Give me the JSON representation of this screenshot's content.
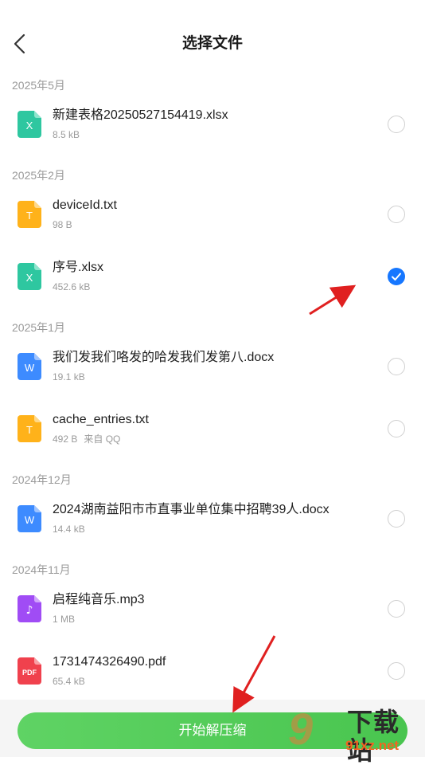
{
  "header": {
    "title": "选择文件",
    "back_icon": "chevron-left-icon"
  },
  "groups": [
    {
      "label": "2025年5月",
      "files": [
        {
          "name": "新建表格20250527154419.xlsx",
          "size": "8.5 kB",
          "source": "",
          "type": "xlsx",
          "checked": false
        }
      ]
    },
    {
      "label": "2025年2月",
      "files": [
        {
          "name": "deviceId.txt",
          "size": "98 B",
          "source": "",
          "type": "txt",
          "checked": false
        },
        {
          "name": "序号.xlsx",
          "size": "452.6 kB",
          "source": "",
          "type": "xlsx",
          "checked": true
        }
      ]
    },
    {
      "label": "2025年1月",
      "files": [
        {
          "name": "我们发我们咯发的哈发我们发第八.docx",
          "size": "19.1 kB",
          "source": "",
          "type": "docx",
          "checked": false
        },
        {
          "name": "cache_entries.txt",
          "size": "492 B",
          "source": "来自 QQ",
          "type": "txt",
          "checked": false
        }
      ]
    },
    {
      "label": "2024年12月",
      "files": [
        {
          "name": "2024湖南益阳市市直事业单位集中招聘39人.docx",
          "size": "14.4 kB",
          "source": "",
          "type": "docx",
          "checked": false
        }
      ]
    },
    {
      "label": "2024年11月",
      "files": [
        {
          "name": "启程纯音乐.mp3",
          "size": "1 MB",
          "source": "",
          "type": "mp3",
          "checked": false
        },
        {
          "name": "1731474326490.pdf",
          "size": "65.4 kB",
          "source": "",
          "type": "pdf",
          "checked": false
        }
      ]
    }
  ],
  "icon_letters": {
    "xlsx": "X",
    "txt": "T",
    "docx": "W",
    "mp3": "♪",
    "pdf": "PDF"
  },
  "colors": {
    "xlsx": "#2ec7a0",
    "txt": "#ffb21a",
    "docx": "#3d8bff",
    "mp3": "#a04cf5",
    "pdf": "#f0414d",
    "accent": "#1677ff",
    "button": "#4fc856"
  },
  "bottom": {
    "action_label": "开始解压缩"
  },
  "watermark": {
    "big": "9",
    "cn": "下载站",
    "url": "91xz.net"
  }
}
